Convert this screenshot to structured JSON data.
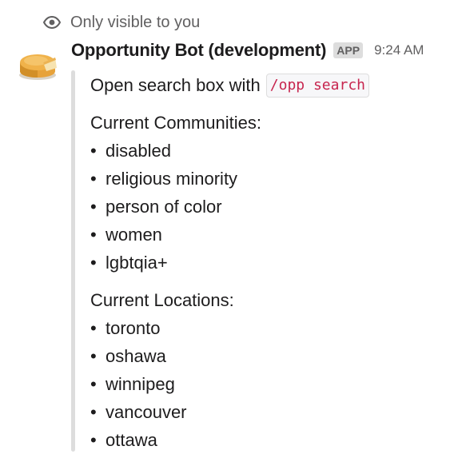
{
  "notice": {
    "icon": "eye-icon",
    "text": "Only visible to you"
  },
  "message": {
    "avatar_icon": "cheesecake-avatar",
    "sender": "Opportunity Bot (development)",
    "badge": "APP",
    "time": "9:24 AM"
  },
  "attachment": {
    "intro_text": "Open search box with",
    "command": "/opp search",
    "communities": {
      "title": "Current Communities:",
      "items": [
        "disabled",
        "religious minority",
        "person of color",
        "women",
        "lgbtqia+"
      ]
    },
    "locations": {
      "title": "Current Locations:",
      "items": [
        "toronto",
        "oshawa",
        "winnipeg",
        "vancouver",
        "ottawa"
      ]
    },
    "bullet": "•"
  },
  "colors": {
    "muted_text": "#616061",
    "code_text": "#c7254e",
    "attachment_bar": "#dddddd"
  }
}
